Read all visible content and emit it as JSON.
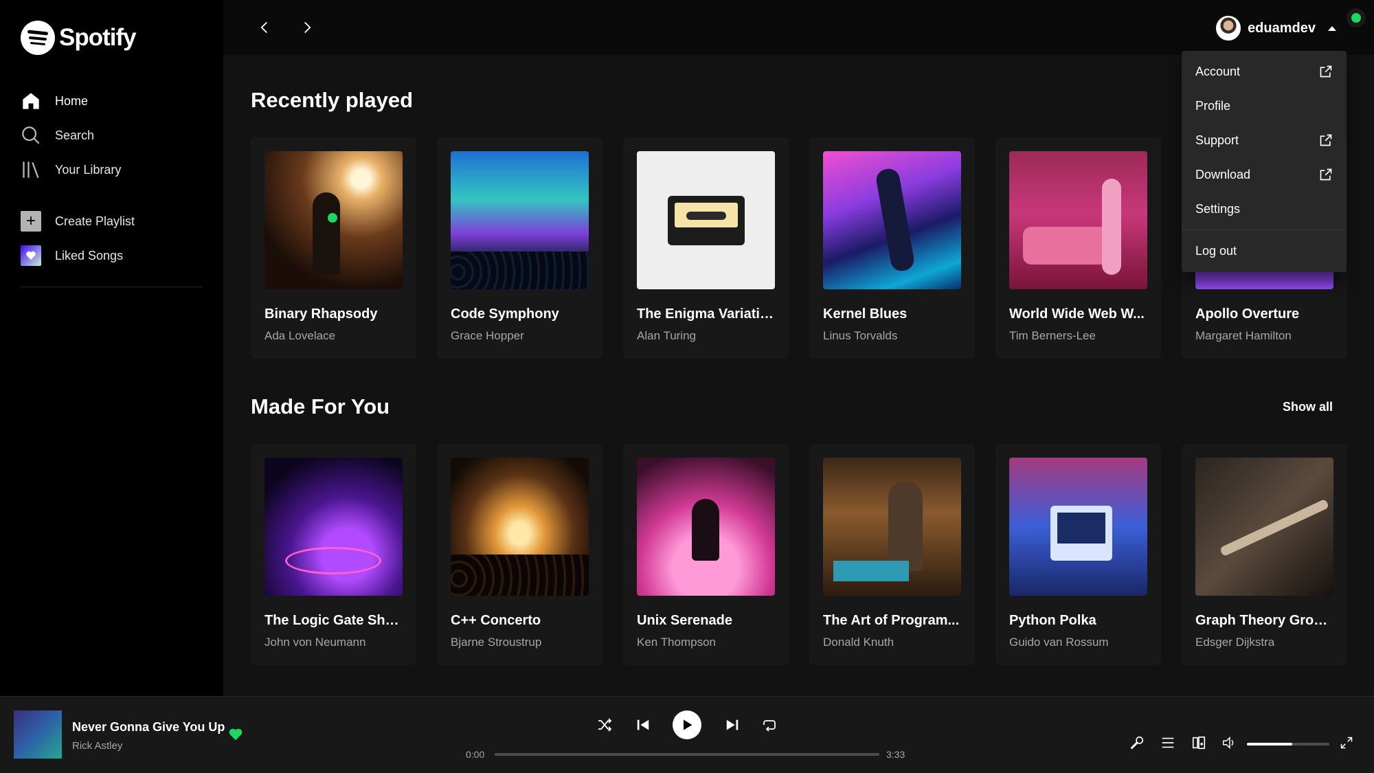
{
  "app": {
    "brand": "Spotify"
  },
  "sidebar": {
    "items": [
      {
        "label": "Home",
        "icon": "home-icon"
      },
      {
        "label": "Search",
        "icon": "search-icon"
      },
      {
        "label": "Your Library",
        "icon": "library-icon"
      }
    ],
    "actions": [
      {
        "label": "Create Playlist",
        "icon": "plus-icon"
      },
      {
        "label": "Liked Songs",
        "icon": "heart-icon"
      }
    ]
  },
  "topbar": {
    "username": "eduamdev",
    "status_color": "#1ed760"
  },
  "user_menu": {
    "items": [
      {
        "label": "Account",
        "external": true
      },
      {
        "label": "Profile",
        "external": false
      },
      {
        "label": "Support",
        "external": true
      },
      {
        "label": "Download",
        "external": true
      },
      {
        "label": "Settings",
        "external": false
      }
    ],
    "logout": "Log out"
  },
  "sections": {
    "recent": {
      "title": "Recently played",
      "cards": [
        {
          "title": "Binary Rhapsody",
          "subtitle": "Ada Lovelace"
        },
        {
          "title": "Code Symphony",
          "subtitle": "Grace Hopper"
        },
        {
          "title": "The Enigma Variatio...",
          "subtitle": "Alan Turing"
        },
        {
          "title": "Kernel Blues",
          "subtitle": "Linus Torvalds"
        },
        {
          "title": "World Wide Web W...",
          "subtitle": "Tim Berners-Lee"
        },
        {
          "title": "Apollo Overture",
          "subtitle": "Margaret Hamilton"
        }
      ]
    },
    "made_for_you": {
      "title": "Made For You",
      "show_all": "Show all",
      "cards": [
        {
          "title": "The Logic Gate Shuf...",
          "subtitle": "John von Neumann"
        },
        {
          "title": "C++ Concerto",
          "subtitle": "Bjarne Stroustrup"
        },
        {
          "title": "Unix Serenade",
          "subtitle": "Ken Thompson"
        },
        {
          "title": "The Art of Program...",
          "subtitle": "Donald Knuth"
        },
        {
          "title": "Python Polka",
          "subtitle": "Guido van Rossum"
        },
        {
          "title": "Graph Theory Groove",
          "subtitle": "Edsger Dijkstra"
        }
      ]
    }
  },
  "player": {
    "track": "Never Gonna Give You Up",
    "artist": "Rick Astley",
    "elapsed": "0:00",
    "duration": "3:33",
    "progress": 0,
    "volume": 0.55,
    "liked_color": "#1ed760"
  }
}
